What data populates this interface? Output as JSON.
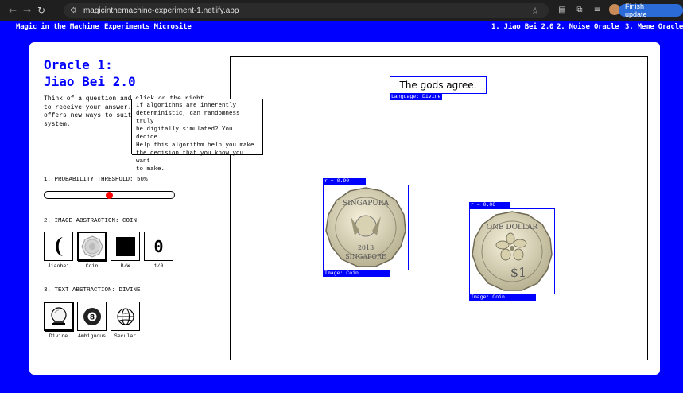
{
  "browser": {
    "url": "magicinthemachine-experiment-1.netlify.app",
    "finish_update": "Finish update"
  },
  "nav": {
    "brand": "Magic in the Machine",
    "microsite": "Experiments Microsite",
    "links": [
      "1. Jiao Bei 2.0",
      "2. Noise Oracle",
      "3. Meme Oracle"
    ]
  },
  "oracle": {
    "title_line1": "Oracle 1:",
    "title_line2": "Jiao Bei 2.0",
    "intro_lines": [
      "Think of a question and click on the right",
      "to receive your answer. Jiao",
      "offers new ways to suit your",
      "system."
    ]
  },
  "tooltip": {
    "lines": [
      "If algorithms are inherently",
      "deterministic, can randomness truly",
      "be digitally simulated? You decide.",
      "Help this algorithm help you make",
      "the decision that you know you want",
      "to make."
    ]
  },
  "controls": {
    "probability_label": "1. PROBABILITY THRESHOLD: 50%",
    "probability_value": 0.5,
    "image_label": "2. IMAGE ABSTRACTION: COIN",
    "image_options": [
      {
        "label": "Jiaobei",
        "icon": "crescent-icon",
        "selected": false
      },
      {
        "label": "Coin",
        "icon": "coin-icon",
        "selected": true
      },
      {
        "label": "B/W",
        "icon": "black-square-icon",
        "selected": false
      },
      {
        "label": "1/0",
        "icon": "zero-digit",
        "glyph": "0",
        "selected": false
      }
    ],
    "text_label": "3. TEXT ABSTRACTION: DIVINE",
    "text_options": [
      {
        "label": "Divine",
        "icon": "crystal-ball-icon",
        "selected": true
      },
      {
        "label": "Ambiguous",
        "icon": "eight-ball-icon",
        "glyph": "8",
        "selected": false
      },
      {
        "label": "Secular",
        "icon": "globe-icon",
        "selected": false
      }
    ]
  },
  "result": {
    "answer": "The gods agree.",
    "language_tag": "Language: Divine",
    "coin1": {
      "r_tag": "r = 0.90",
      "image_tag": "Image: Coin",
      "top_text": "SINGAPURA",
      "bottom_text": "SINGAPORE",
      "year": "2013"
    },
    "coin2": {
      "r_tag": "r = 0.06",
      "image_tag": "Image: Coin",
      "top_text": "ONE DOLLAR",
      "value": "$1"
    }
  },
  "colors": {
    "accent": "#0000ff",
    "slider_thumb": "#ff0000",
    "finish_button": "#2a6bd8"
  }
}
